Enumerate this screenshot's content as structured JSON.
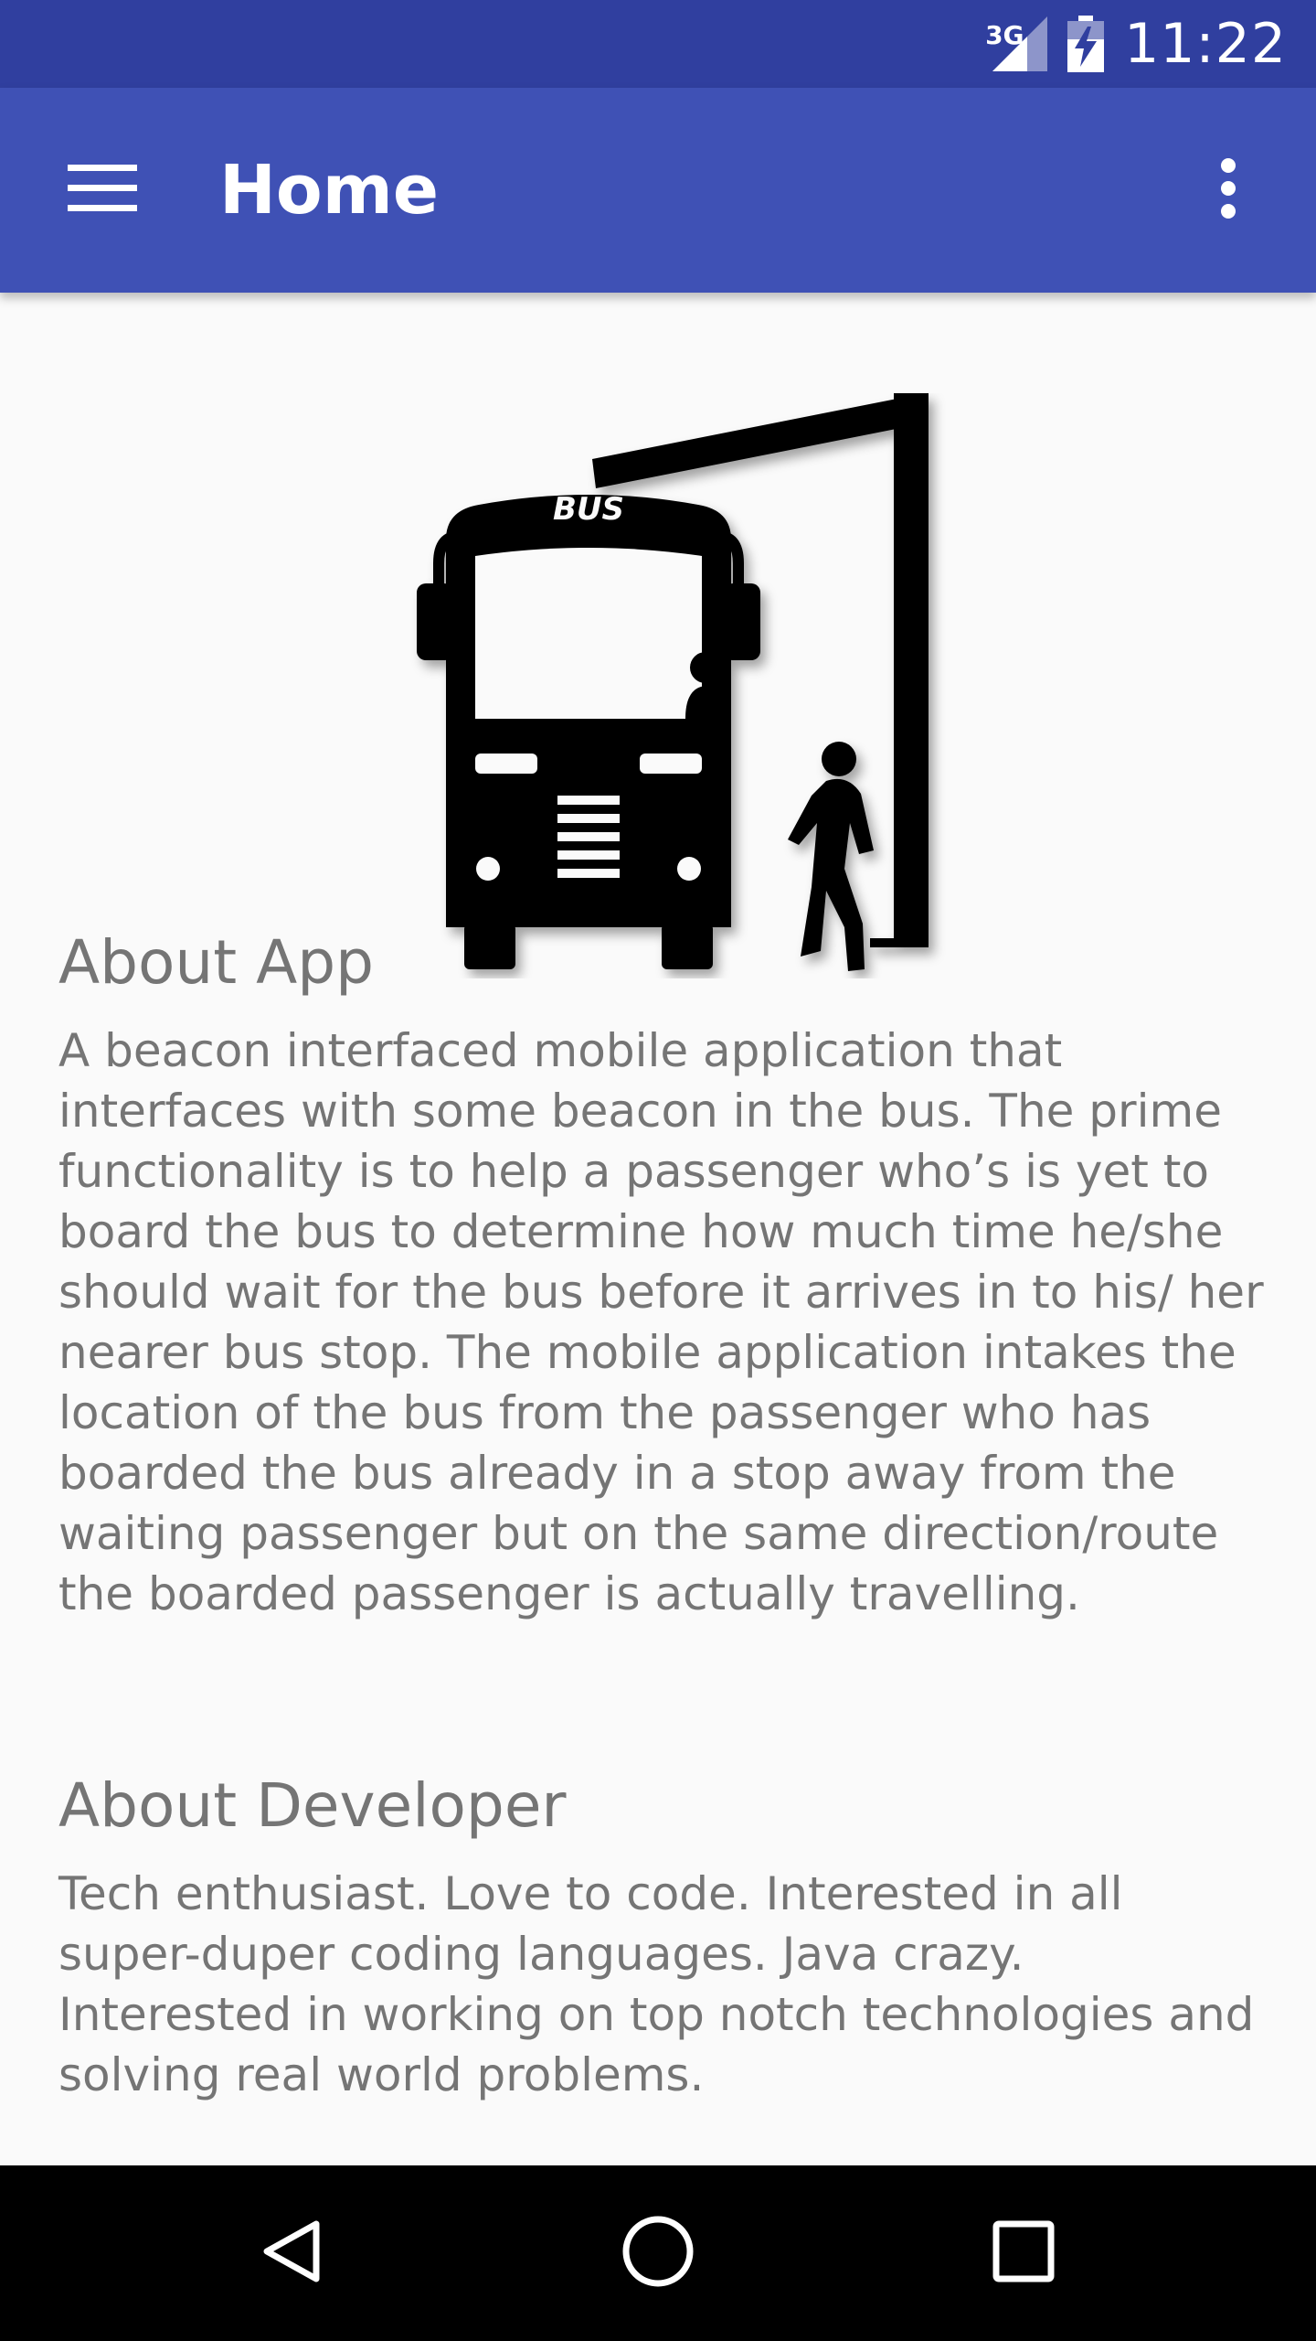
{
  "status_bar": {
    "time": "11:22",
    "network_type": "3G"
  },
  "app_bar": {
    "title": "Home",
    "menu_icon": "hamburger-menu-icon",
    "overflow_icon": "more-vert-icon"
  },
  "illustration": {
    "icon": "bus-stop-illustration",
    "bus_label": "BUS"
  },
  "about_app": {
    "heading": "About App",
    "body": "A beacon interfaced mobile application that interfaces with some beacon in the bus. The prime functionality is to help a passenger who’s is yet to board the bus to determine how much time he/she should wait for the bus before it arrives in to his/ her nearer bus stop. The mobile application intakes the location of the bus from the passenger who has boarded the bus already in a stop away from the waiting passenger but on the same direction/route the boarded passenger is actually travelling."
  },
  "about_developer": {
    "heading": "About Developer",
    "body": "Tech enthusiast. Love to code. Interested in all super-duper coding languages. Java crazy. Interested in working on top notch technologies and solving real world problems."
  },
  "nav_bar": {
    "back_icon": "back-triangle-icon",
    "home_icon": "home-circle-icon",
    "recents_icon": "recents-square-icon"
  },
  "colors": {
    "status_bar": "#303f9f",
    "app_bar": "#3f51b5",
    "background": "#fafafa",
    "text": "#757575"
  }
}
